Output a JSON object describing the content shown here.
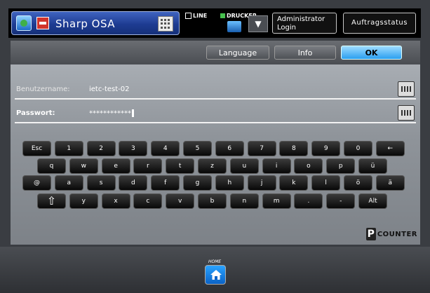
{
  "header": {
    "app_title": "Sharp OSA",
    "status_line": "LINE",
    "status_printer": "DRUCKER",
    "admin_login": "Administrator\nLogin",
    "admin_line1": "Administrator",
    "admin_line2": "Login",
    "job_status": "Auftragsstatus"
  },
  "toolbar": {
    "language": "Language",
    "info": "Info",
    "ok": "OK"
  },
  "form": {
    "username_label": "Benutzername:",
    "username_value": "ietc-test-02",
    "password_label": "Passwort:",
    "password_value": "************"
  },
  "keyboard": {
    "row1": [
      "Esc",
      "1",
      "2",
      "3",
      "4",
      "5",
      "6",
      "7",
      "8",
      "9",
      "0",
      "←"
    ],
    "row2": [
      "q",
      "w",
      "e",
      "r",
      "t",
      "z",
      "u",
      "i",
      "o",
      "p",
      "ü"
    ],
    "row3": [
      "@",
      "a",
      "s",
      "d",
      "f",
      "g",
      "h",
      "j",
      "k",
      "l",
      "ö",
      "ä"
    ],
    "row4": [
      "⇧",
      "y",
      "x",
      "c",
      "v",
      "b",
      "n",
      "m",
      ".",
      "-",
      "Alt"
    ]
  },
  "branding": {
    "counter_p": "P",
    "counter_text": "COUNTER"
  },
  "footer": {
    "home_label": "HOME"
  },
  "colors": {
    "accent_blue": "#2a9ff0",
    "panel": "#8f949a",
    "status_green": "#46c04e"
  }
}
